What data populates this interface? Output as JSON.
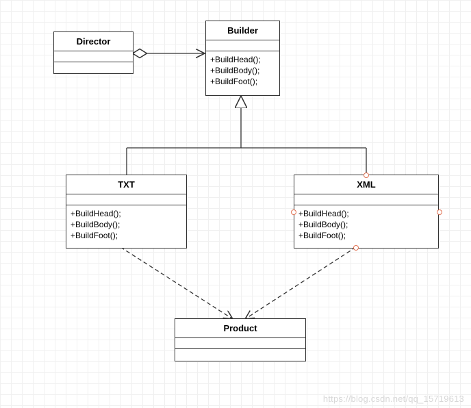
{
  "classes": {
    "director": {
      "name": "Director",
      "ops": []
    },
    "builder": {
      "name": "Builder",
      "ops": [
        "+BuildHead();",
        "+BuildBody();",
        "+BuildFoot();"
      ]
    },
    "txt": {
      "name": "TXT",
      "ops": [
        "+BuildHead();",
        "+BuildBody();",
        "+BuildFoot();"
      ]
    },
    "xml": {
      "name": "XML",
      "ops": [
        "+BuildHead();",
        "+BuildBody();",
        "+BuildFoot();"
      ]
    },
    "product": {
      "name": "Product",
      "ops": []
    }
  },
  "watermark": "https://blog.csdn.net/qq_15719613",
  "relations": [
    {
      "from": "Director",
      "to": "Builder",
      "type": "aggregation"
    },
    {
      "from": "TXT",
      "to": "Builder",
      "type": "generalization"
    },
    {
      "from": "XML",
      "to": "Builder",
      "type": "generalization"
    },
    {
      "from": "TXT",
      "to": "Product",
      "type": "dependency"
    },
    {
      "from": "XML",
      "to": "Product",
      "type": "dependency"
    }
  ]
}
